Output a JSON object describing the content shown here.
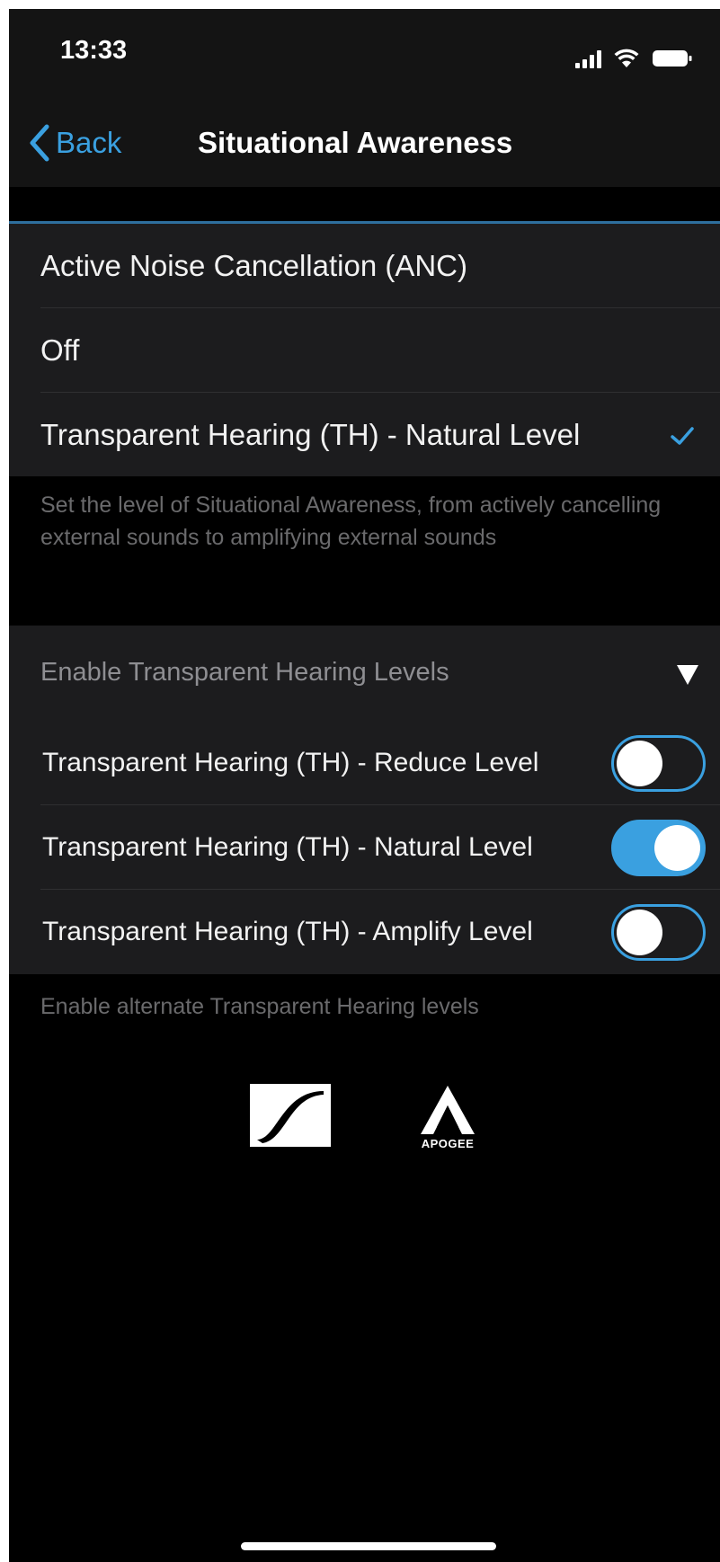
{
  "status_bar": {
    "time": "13:33"
  },
  "nav": {
    "back_label": "Back",
    "title": "Situational Awareness"
  },
  "mode_options": [
    {
      "label": "Active Noise Cancellation (ANC)",
      "selected": false
    },
    {
      "label": "Off",
      "selected": false
    },
    {
      "label": "Transparent Hearing (TH) - Natural Level",
      "selected": true
    }
  ],
  "mode_footer": "Set the level of Situational Awareness, from actively cancelling external sounds to amplifying external sounds",
  "levels_section": {
    "header": "Enable Transparent Hearing Levels",
    "items": [
      {
        "label": "Transparent Hearing (TH) - Reduce Level",
        "enabled": false
      },
      {
        "label": "Transparent Hearing (TH) - Natural Level",
        "enabled": true
      },
      {
        "label": "Transparent Hearing (TH) - Amplify Level",
        "enabled": false
      }
    ],
    "footer": "Enable alternate Transparent Hearing levels"
  },
  "logos": {
    "sennheiser_icon": "sennheiser-logo",
    "apogee_text": "APOGEE"
  },
  "colors": {
    "accent": "#3aa0e0",
    "cell_background": "#1c1c1e",
    "background": "#000000"
  }
}
